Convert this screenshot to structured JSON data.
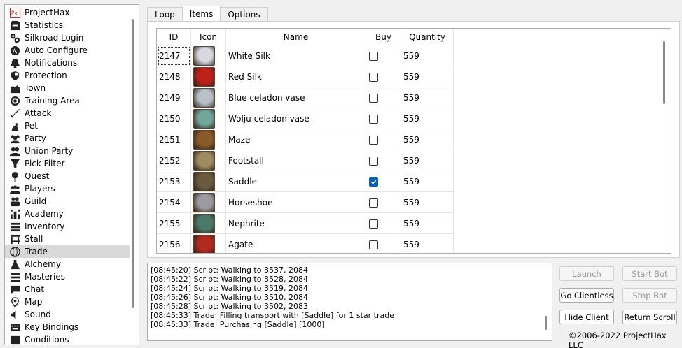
{
  "sidebar": {
    "items": [
      {
        "label": "ProjectHax",
        "icon": "projecthax-logo-icon"
      },
      {
        "label": "Statistics",
        "icon": "statistics-icon"
      },
      {
        "label": "Silkroad Login",
        "icon": "login-gears-icon"
      },
      {
        "label": "Auto Configure",
        "icon": "auto-configure-icon"
      },
      {
        "label": "Notifications",
        "icon": "bell-icon"
      },
      {
        "label": "Protection",
        "icon": "shield-icon"
      },
      {
        "label": "Town",
        "icon": "town-icon"
      },
      {
        "label": "Training Area",
        "icon": "target-icon"
      },
      {
        "label": "Attack",
        "icon": "sword-icon"
      },
      {
        "label": "Pet",
        "icon": "pet-icon"
      },
      {
        "label": "Party",
        "icon": "party-icon"
      },
      {
        "label": "Union Party",
        "icon": "union-party-icon"
      },
      {
        "label": "Pick Filter",
        "icon": "funnel-icon"
      },
      {
        "label": "Quest",
        "icon": "quest-icon"
      },
      {
        "label": "Players",
        "icon": "players-icon"
      },
      {
        "label": "Guild",
        "icon": "guild-icon"
      },
      {
        "label": "Academy",
        "icon": "academy-icon"
      },
      {
        "label": "Inventory",
        "icon": "inventory-icon"
      },
      {
        "label": "Stall",
        "icon": "stall-icon"
      },
      {
        "label": "Trade",
        "icon": "globe-icon",
        "selected": true
      },
      {
        "label": "Alchemy",
        "icon": "alchemy-icon"
      },
      {
        "label": "Masteries",
        "icon": "masteries-icon"
      },
      {
        "label": "Chat",
        "icon": "chat-icon"
      },
      {
        "label": "Map",
        "icon": "map-pin-icon"
      },
      {
        "label": "Sound",
        "icon": "speaker-icon"
      },
      {
        "label": "Key Bindings",
        "icon": "keyboard-icon"
      },
      {
        "label": "Conditions",
        "icon": "conditions-icon"
      }
    ]
  },
  "tabs": [
    {
      "label": "Loop",
      "active": false
    },
    {
      "label": "Items",
      "active": true
    },
    {
      "label": "Options",
      "active": false
    }
  ],
  "table": {
    "headers": {
      "id": "ID",
      "icon": "Icon",
      "name": "Name",
      "buy": "Buy",
      "quantity": "Quantity"
    },
    "rows": [
      {
        "id": "2147",
        "name": "White Silk",
        "buy": false,
        "quantity": "559",
        "icon": "white-silk-icon",
        "color": "#d8d8e0"
      },
      {
        "id": "2148",
        "name": "Red Silk",
        "buy": false,
        "quantity": "559",
        "icon": "red-silk-icon",
        "color": "#c0201a"
      },
      {
        "id": "2149",
        "name": "Blue celadon vase",
        "buy": false,
        "quantity": "559",
        "icon": "vase-icon",
        "color": "#b8c0c8"
      },
      {
        "id": "2150",
        "name": "Wolju celadon vase",
        "buy": false,
        "quantity": "559",
        "icon": "vase-icon",
        "color": "#6fa89a"
      },
      {
        "id": "2151",
        "name": "Maze",
        "buy": false,
        "quantity": "559",
        "icon": "maze-icon",
        "color": "#8a5a2a"
      },
      {
        "id": "2152",
        "name": "Footstall",
        "buy": false,
        "quantity": "559",
        "icon": "footstall-icon",
        "color": "#a08a60"
      },
      {
        "id": "2153",
        "name": "Saddle",
        "buy": true,
        "quantity": "559",
        "icon": "saddle-icon",
        "color": "#6a5a40"
      },
      {
        "id": "2154",
        "name": "Horseshoe",
        "buy": false,
        "quantity": "559",
        "icon": "horseshoe-icon",
        "color": "#9a9aa0"
      },
      {
        "id": "2155",
        "name": "Nephrite",
        "buy": false,
        "quantity": "559",
        "icon": "nephrite-icon",
        "color": "#4a7a6a"
      },
      {
        "id": "2156",
        "name": "Agate",
        "buy": false,
        "quantity": "559",
        "icon": "agate-icon",
        "color": "#b02a20"
      }
    ]
  },
  "log": {
    "lines": [
      "[08:45:20] Script: Walking to 3537, 2084",
      "[08:45:22] Script: Walking to 3528, 2084",
      "[08:45:24] Script: Walking to 3519, 2084",
      "[08:45:26] Script: Walking to 3510, 2084",
      "[08:45:28] Script: Walking to 3502, 2083",
      "[08:45:33] Trade: Filling transport with [Saddle] for 1 star trade",
      "[08:45:33] Trade: Purchasing [Saddle] [1000]"
    ]
  },
  "buttons": {
    "launch": {
      "label": "Launch",
      "enabled": false
    },
    "start_bot": {
      "label": "Start Bot",
      "enabled": false
    },
    "go_clientless": {
      "label": "Go Clientless",
      "enabled": true
    },
    "stop_bot": {
      "label": "Stop Bot",
      "enabled": false
    },
    "hide_client": {
      "label": "Hide Client",
      "enabled": true
    },
    "return_scroll": {
      "label": "Return Scroll",
      "enabled": true
    }
  },
  "footer": {
    "copyright": "©2006-2022 ProjectHax LLC"
  }
}
